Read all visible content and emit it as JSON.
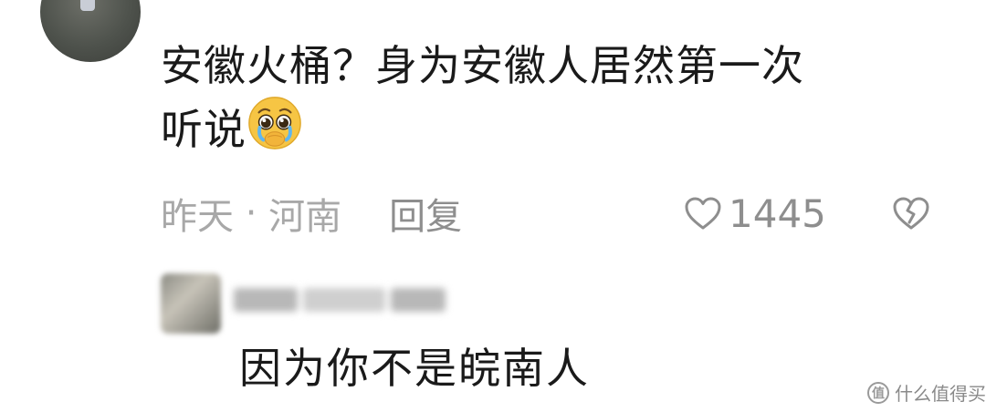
{
  "comment": {
    "username": "",
    "text_line1": "安徽火桶？身为安徽人居然第一次",
    "text_line2": "听说",
    "emoji": "pleading-face-emoji",
    "time": "昨天",
    "separator": " · ",
    "location": "河南",
    "reply_label": "回复",
    "like_count": "1445",
    "like_icon": "heart-outline-icon",
    "dislike_icon": "broken-heart-icon"
  },
  "reply": {
    "text": "因为你不是皖南人"
  },
  "watermark": {
    "badge": "值",
    "text": "什么值得买"
  },
  "colors": {
    "text_primary": "#1a1a1a",
    "text_meta": "#a8a8a8",
    "icon": "#8e8e8e",
    "emoji_yellow": "#f6c544"
  }
}
